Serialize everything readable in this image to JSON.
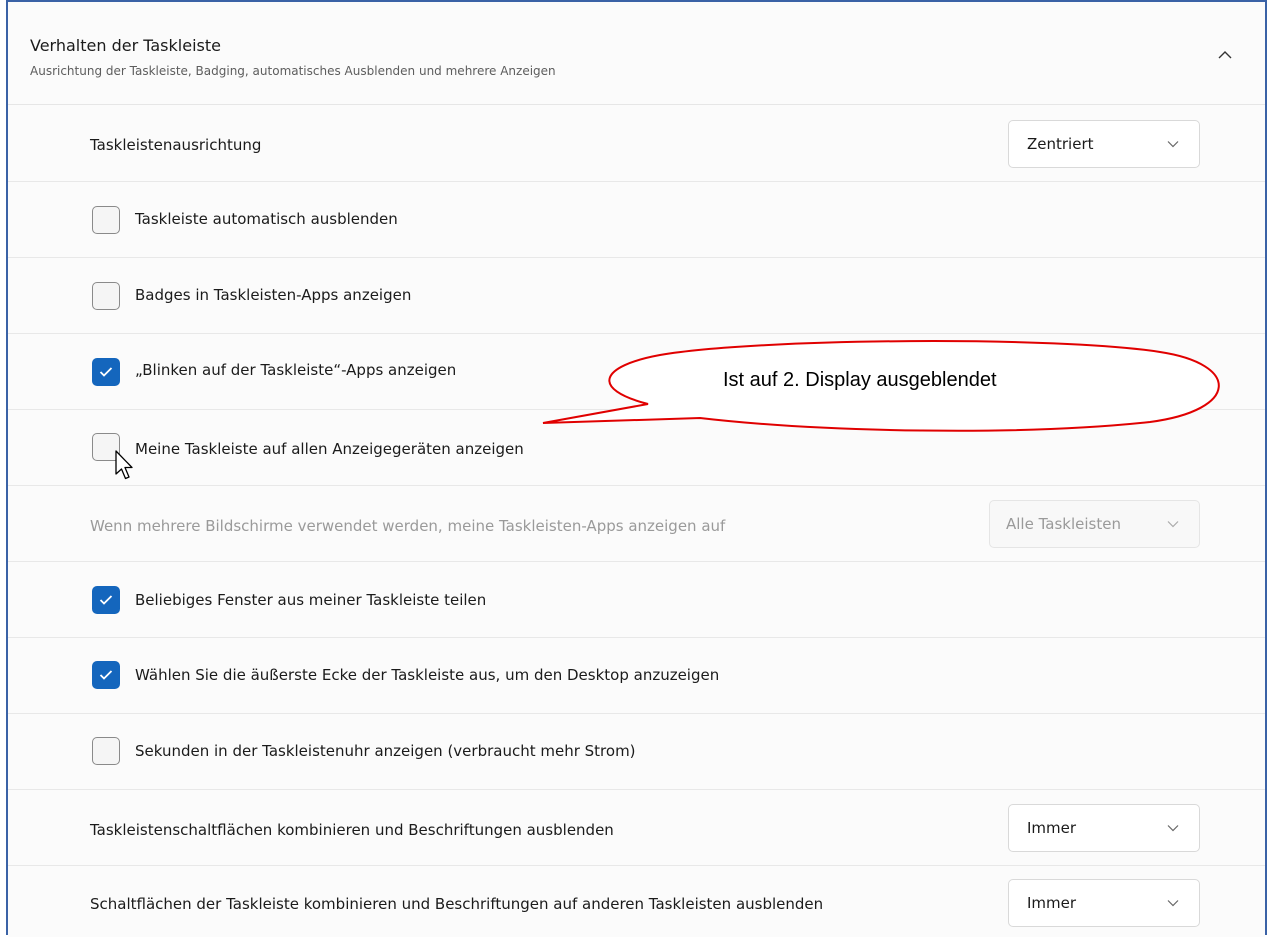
{
  "section": {
    "title": "Verhalten der Taskleiste",
    "subtitle": "Ausrichtung der Taskleiste, Badging, automatisches Ausblenden und mehrere Anzeigen",
    "collapse_icon": "chevron-up-icon"
  },
  "rows": {
    "alignment": {
      "label": "Taskleistenausrichtung",
      "value": "Zentriert"
    },
    "autohide": {
      "label": "Taskleiste automatisch ausblenden",
      "checked": false
    },
    "badges": {
      "label": "Badges in Taskleisten-Apps anzeigen",
      "checked": false
    },
    "flashing": {
      "label": "„Blinken auf der Taskleiste“-Apps anzeigen",
      "checked": true
    },
    "all_displays": {
      "label": "Meine Taskleiste auf allen Anzeigegeräten anzeigen",
      "checked": false
    },
    "multi_monitor": {
      "label": "Wenn mehrere Bildschirme verwendet werden, meine Taskleisten-Apps anzeigen auf",
      "value": "Alle Taskleisten",
      "disabled": true
    },
    "share_window": {
      "label": "Beliebiges Fenster aus meiner Taskleiste teilen",
      "checked": true
    },
    "far_corner": {
      "label": "Wählen Sie die äußerste Ecke der Taskleiste aus, um den Desktop anzuzeigen",
      "checked": true
    },
    "seconds": {
      "label": "Sekunden in der Taskleistenuhr anzeigen (verbraucht mehr Strom)",
      "checked": false
    },
    "combine": {
      "label": "Taskleistenschaltflächen kombinieren und Beschriftungen ausblenden",
      "value": "Immer"
    },
    "combine_other": {
      "label": "Schaltflächen der Taskleiste kombinieren und Beschriftungen auf anderen Taskleisten ausblenden",
      "value": "Immer"
    }
  },
  "annotation": {
    "text": "Ist auf 2. Display ausgeblendet",
    "color": "#e00000"
  },
  "colors": {
    "accent": "#1466bd",
    "frame": "#3a62a6"
  }
}
